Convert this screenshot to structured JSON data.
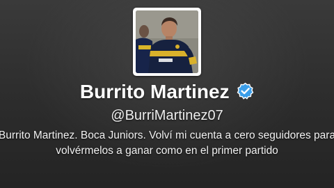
{
  "profile": {
    "name": "Burrito Martinez",
    "handle": "@BurriMartinez07",
    "verified": true,
    "bio_line1": "Burrito Martinez. Boca Juniors. Volví mi cuenta a cero seguidores para",
    "bio_line2": "volvérmelos a ganar como en el primer partido",
    "avatar_icon": "profile-photo",
    "verified_icon": "verified-check-icon"
  },
  "colors": {
    "header_background": "#2e2e2e",
    "text": "#ffffff",
    "verified_badge": "#3b9ee9"
  }
}
